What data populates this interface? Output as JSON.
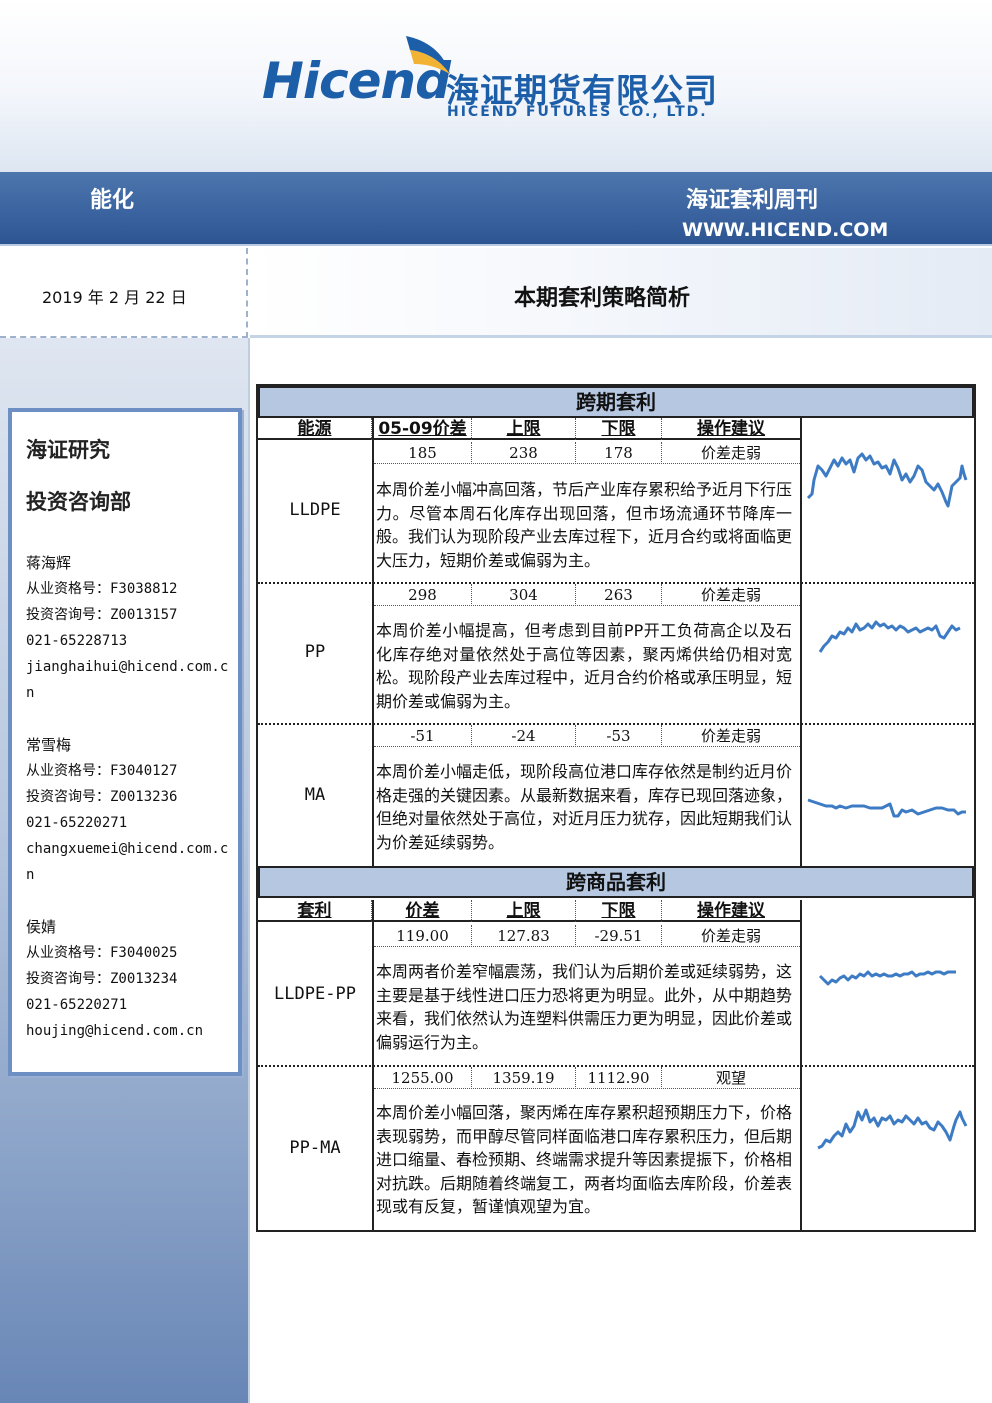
{
  "header": {
    "logo_word": "Hicend",
    "logo_cn": "海证期货有限公司",
    "logo_en": "HICEND FUTURES CO., LTD.",
    "sector": "能化",
    "publication": "海证套利周刊",
    "url": "WWW.HICEND.COM"
  },
  "date": "2019 年 2 月 22 日",
  "main_title": "本期套利策略简析",
  "sidebar": {
    "dept1": "海证研究",
    "dept2": "投资咨询部",
    "analysts": [
      {
        "name": "蒋海辉",
        "license": "从业资格号：F3038812",
        "advisory": "投资咨询号：Z0013157",
        "phone": "021-65228713",
        "email": "jianghaihui@hicend.com.cn"
      },
      {
        "name": "常雪梅",
        "license": "从业资格号：F3040127",
        "advisory": "投资咨询号：Z0013236",
        "phone": "021-65220271",
        "email": "changxuemei@hicend.com.cn"
      },
      {
        "name": "侯婧",
        "license": "从业资格号：F3040025",
        "advisory": "投资咨询号：Z0013234",
        "phone": "021-65220271",
        "email": "houjing@hicend.com.cn"
      }
    ]
  },
  "intertemporal": {
    "title": "跨期套利",
    "headers": [
      "能源",
      "05-09价差",
      "上限",
      "下限",
      "操作建议"
    ],
    "rows": [
      {
        "name": "LLDPE",
        "values": [
          "185",
          "238",
          "178",
          "价差走弱"
        ],
        "text": "本周价差小幅冲高回落，节后产业库存累积给予近月下行压力。尽管本周石化库存出现回落，但市场流通环节降库一般。我们认为现阶段产业去库过程下，近月合约或将面临更大压力，短期价差或偏弱为主。"
      },
      {
        "name": "PP",
        "values": [
          "298",
          "304",
          "263",
          "价差走弱"
        ],
        "text": "本周价差小幅提高，但考虑到目前PP开工负荷高企以及石化库存绝对量依然处于高位等因素，聚丙烯供给仍相对宽松。现阶段产业去库过程中，近月合约价格或承压明显，短期价差或偏弱为主。"
      },
      {
        "name": "MA",
        "values": [
          "-51",
          "-24",
          "-53",
          "价差走弱"
        ],
        "text": "本周价差小幅走低，现阶段高位港口库存依然是制约近月价格走强的关键因素。从最新数据来看，库存已现回落迹象，但绝对量依然处于高位，对近月压力犹存，因此短期我们认为价差延续弱势。"
      }
    ]
  },
  "intercommodity": {
    "title": "跨商品套利",
    "headers": [
      "套利",
      "价差",
      "上限",
      "下限",
      "操作建议"
    ],
    "rows": [
      {
        "name": "LLDPE-PP",
        "values": [
          "119.00",
          "127.83",
          "-29.51",
          "价差走弱"
        ],
        "text": "本周两者价差窄幅震荡，我们认为后期价差或延续弱势，这主要是基于线性进口压力恐将更为明显。此外，从中期趋势来看，我们依然认为连塑料供需压力更为明显，因此价差或偏弱运行为主。"
      },
      {
        "name": "PP-MA",
        "values": [
          "1255.00",
          "1359.19",
          "1112.90",
          "观望"
        ],
        "text": "本周价差小幅回落，聚丙烯在库存累积超预期压力下，价格表现弱势，而甲醇尽管同样面临港口库存累积压力，但后期进口缩量、春检预期、终端需求提升等因素提振下，价格相对抗跌。后期随着终端复工，两者均面临去库阶段，价差表现或有反复，暂谨慎观望为宜。"
      }
    ]
  },
  "colors": {
    "brand": "#1d5ea8",
    "bar": "#3b64a0",
    "section_head": "#b6c7e2",
    "spark": "#3d7cc4"
  }
}
